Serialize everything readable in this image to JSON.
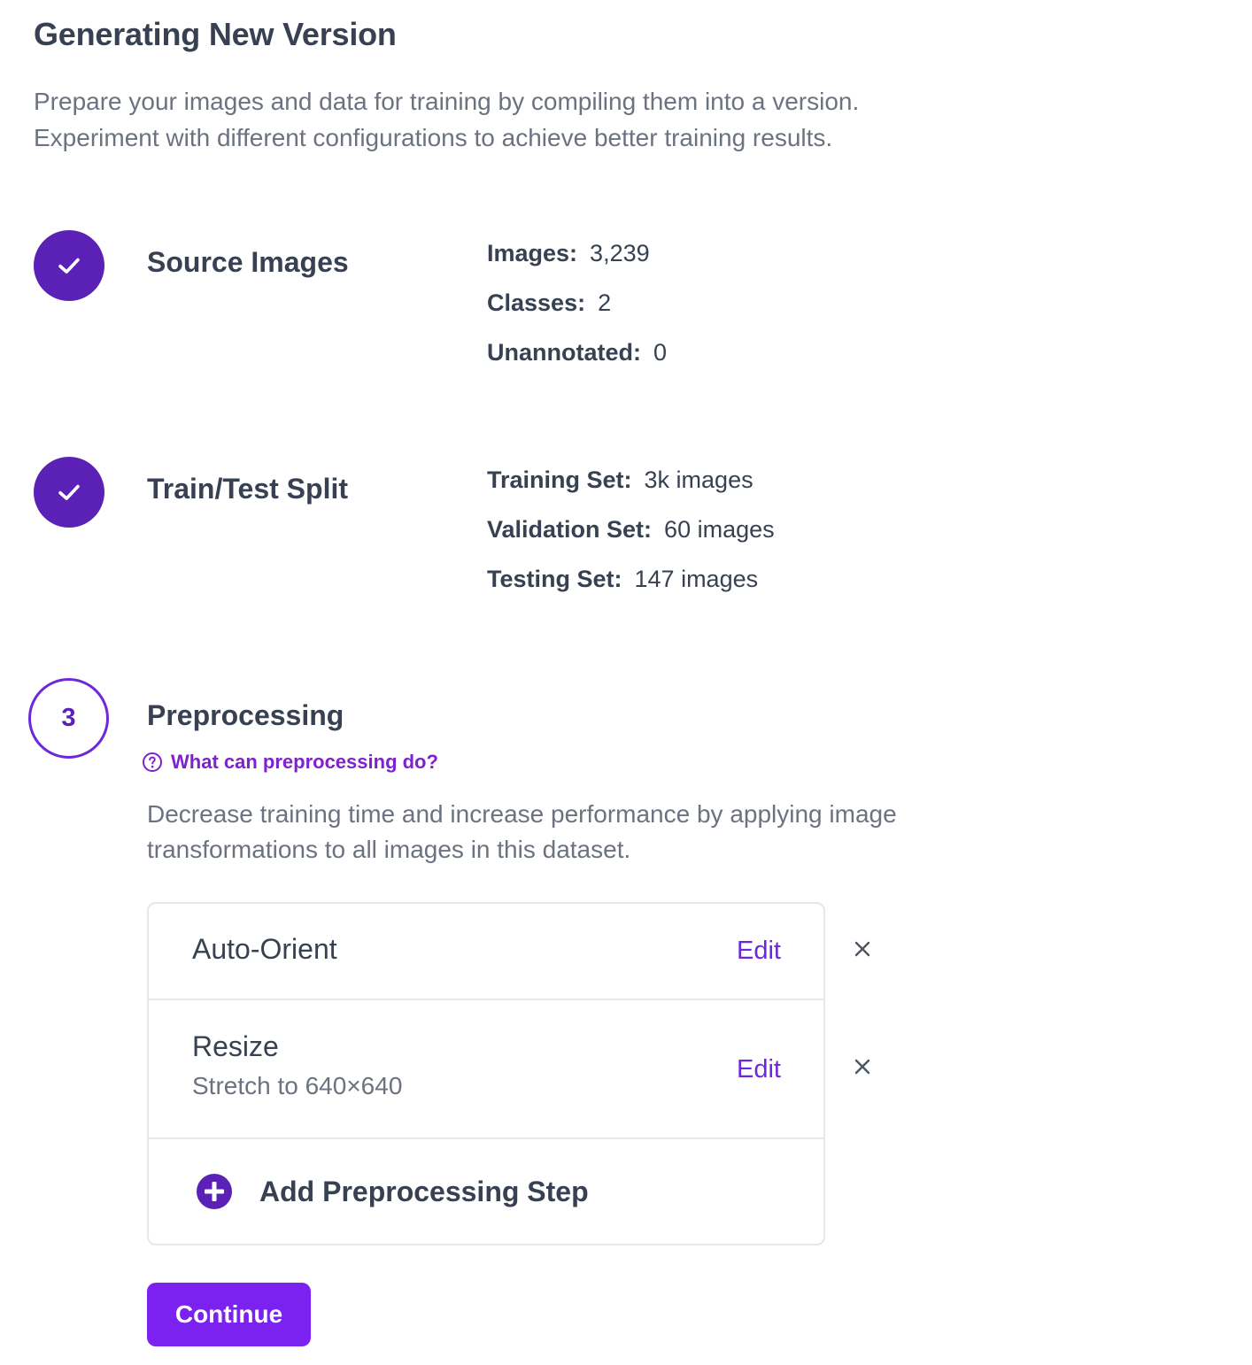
{
  "header": {
    "title": "Generating New Version",
    "description_line1": "Prepare your images and data for training by compiling them into a version.",
    "description_line2": "Experiment with different configurations to achieve better training results."
  },
  "steps": [
    {
      "title": "Source Images",
      "status": "complete",
      "icon": "check-icon",
      "stats": [
        {
          "label": "Images:",
          "value": "3,239"
        },
        {
          "label": "Classes:",
          "value": "2"
        },
        {
          "label": "Unannotated:",
          "value": "0"
        }
      ]
    },
    {
      "title": "Train/Test Split",
      "status": "complete",
      "icon": "check-icon",
      "stats": [
        {
          "label": "Training Set:",
          "value": "3k images"
        },
        {
          "label": "Validation Set:",
          "value": "60 images"
        },
        {
          "label": "Testing Set:",
          "value": "147 images"
        }
      ]
    },
    {
      "number": "3",
      "title": "Preprocessing",
      "status": "active"
    }
  ],
  "preprocessing": {
    "help_link": "What can preprocessing do?",
    "description_line1": "Decrease training time and increase performance by applying image",
    "description_line2": "transformations to all images in this dataset.",
    "items": [
      {
        "name": "Auto-Orient",
        "detail": "",
        "edit_label": "Edit"
      },
      {
        "name": "Resize",
        "detail": "Stretch to 640×640",
        "edit_label": "Edit"
      }
    ],
    "add_step_label": "Add Preprocessing Step",
    "continue_label": "Continue"
  },
  "colors": {
    "accent": "#5b21b6",
    "link": "#6d28d9",
    "button": "#7c22f0",
    "text": "#374151",
    "muted": "#6b7280"
  }
}
